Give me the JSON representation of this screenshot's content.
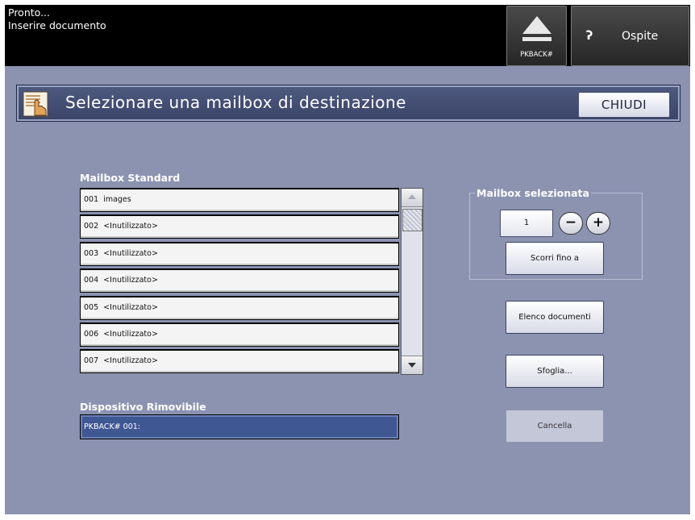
{
  "status": {
    "line1": "Pronto...",
    "line2": "Inserire documento"
  },
  "header": {
    "eject_label": "PKBACK#",
    "user_label": "Ospite"
  },
  "dialog": {
    "title": "Selezionare una mailbox di destinazione",
    "close_label": "CHIUDI"
  },
  "mailbox_standard": {
    "label": "Mailbox Standard",
    "items": [
      {
        "number": "001",
        "name": "images"
      },
      {
        "number": "002",
        "name": "<Inutilizzato>"
      },
      {
        "number": "003",
        "name": "<Inutilizzato>"
      },
      {
        "number": "004",
        "name": "<Inutilizzato>"
      },
      {
        "number": "005",
        "name": "<Inutilizzato>"
      },
      {
        "number": "006",
        "name": "<Inutilizzato>"
      },
      {
        "number": "007",
        "name": "<Inutilizzato>"
      }
    ]
  },
  "removable_device": {
    "label": "Dispositivo Rimovibile",
    "value": "PKBACK# 001:"
  },
  "selected_mailbox": {
    "label": "Mailbox selezionata",
    "value": "1",
    "minus": "−",
    "plus": "+"
  },
  "buttons": {
    "scroll_to": "Scorri fino a",
    "document_list": "Elenco documenti",
    "browse": "Sfoglia...",
    "delete": "Cancella"
  }
}
